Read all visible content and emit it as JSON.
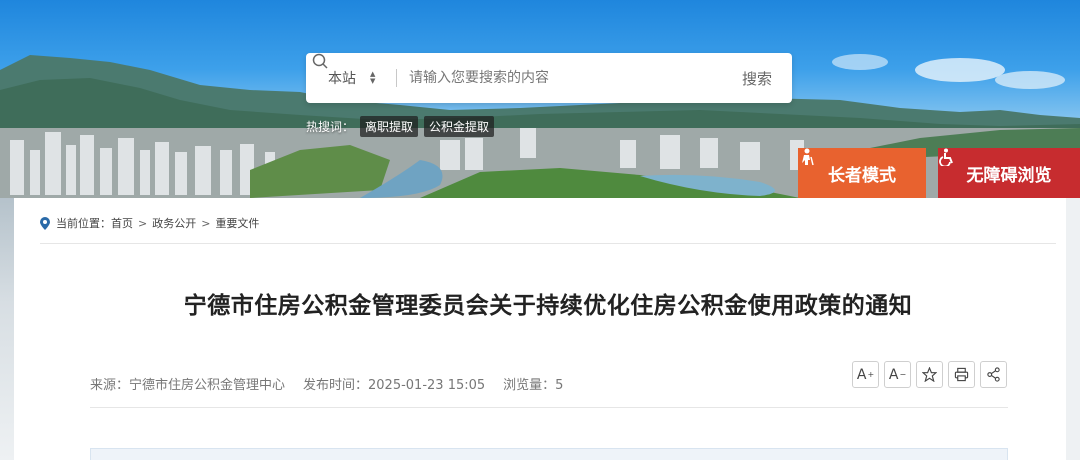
{
  "search": {
    "scope_label": "本站",
    "placeholder": "请输入您要搜索的内容",
    "button_label": "搜索"
  },
  "hot_search": {
    "label": "热搜词：",
    "tags": [
      "离职提取",
      "公积金提取"
    ]
  },
  "modes": {
    "elder_label": "长者模式",
    "accessible_label": "无障碍浏览"
  },
  "breadcrumb": {
    "label": "当前位置：",
    "items": [
      "首页",
      "政务公开",
      "重要文件"
    ],
    "separator": ">"
  },
  "article": {
    "title": "宁德市住房公积金管理委员会关于持续优化住房公积金使用政策的通知",
    "source": "来源：宁德市住房公积金管理中心",
    "publish_time": "发布时间：2025-01-23 15:05",
    "views": "浏览量：5"
  },
  "tools": {
    "font_increase": "A",
    "font_increase_sup": "+",
    "font_decrease": "A",
    "font_decrease_sup": "−",
    "icons": [
      "font-increase-icon",
      "font-decrease-icon",
      "star-icon",
      "print-icon",
      "share-icon"
    ]
  },
  "colors": {
    "elder_mode": "#e8622f",
    "accessible_mode": "#c72c2f",
    "title_text": "#222222",
    "meta_text": "#777777"
  }
}
